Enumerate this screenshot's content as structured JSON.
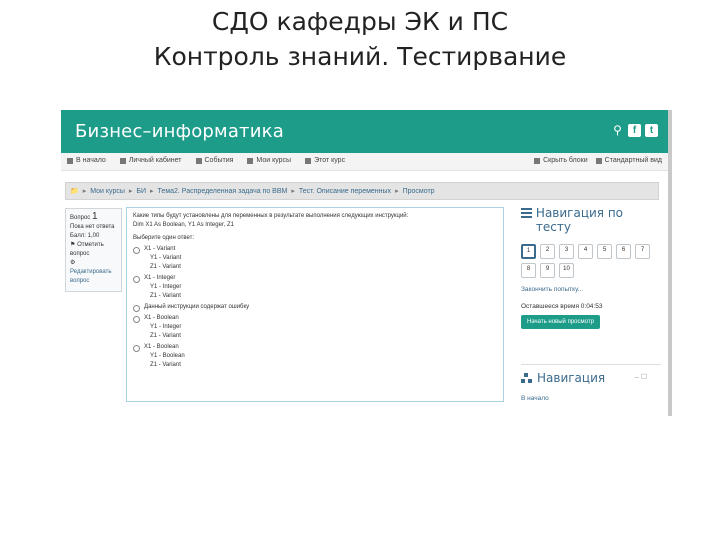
{
  "slide": {
    "title_line1": "СДО кафедры ЭК и ПС",
    "title_line2": "Контроль знаний. Тестирвание"
  },
  "site": {
    "brand": "Бизнес–информатика",
    "icons": [
      "search-icon",
      "facebook-icon",
      "twitter-icon"
    ],
    "colors": {
      "brand": "#1d9c8a",
      "link": "#3a6a8c"
    }
  },
  "navbar": {
    "items": [
      "В начало",
      "Личный кабинет",
      "События",
      "Мои курсы",
      "Этот курс"
    ],
    "right": [
      "Скрыть блоки",
      "Стандартный вид"
    ]
  },
  "breadcrumb": [
    "Мои курсы",
    "БИ",
    "Тема2. Распределенная задача по ВВМ",
    "Тест. Описание переменных",
    "Просмотр"
  ],
  "question_info": {
    "label": "Вопрос",
    "number": "1",
    "status": "Пока нет ответа",
    "score": "Балл: 1,00",
    "flag": "Отметить вопрос",
    "edit": "Редактировать вопрос"
  },
  "question": {
    "text": "Какие типы будут установлены для переменных в результате выполнения следующих инструкций:",
    "code": "Dim X1 As Boolean, Y1 As Integer, Z1",
    "prompt": "Выберите один ответ:",
    "options": [
      [
        "X1 - Variant",
        "Y1 - Variant",
        "Z1 - Variant"
      ],
      [
        "X1 - Integer",
        "Y1 - Integer",
        "Z1 - Variant"
      ],
      [
        "Данный инструкции содержат ошибку"
      ],
      [
        "X1 - Boolean",
        "Y1 - Integer",
        "Z1 - Variant"
      ],
      [
        "X1 - Boolean",
        "Y1 - Boolean",
        "Z1 - Variant"
      ]
    ]
  },
  "quiz_nav": {
    "title": "Навигация по тесту",
    "numbers": [
      "1",
      "2",
      "3",
      "4",
      "5",
      "6",
      "7",
      "8",
      "9",
      "10"
    ],
    "active": "1",
    "finish_link": "Закончить попытку...",
    "remaining": "Оставшееся время 0:04:53",
    "new_preview": "Начать новый просмотр"
  },
  "navigation": {
    "title": "Навигация",
    "controls": "– ☐",
    "home": "В начало"
  }
}
